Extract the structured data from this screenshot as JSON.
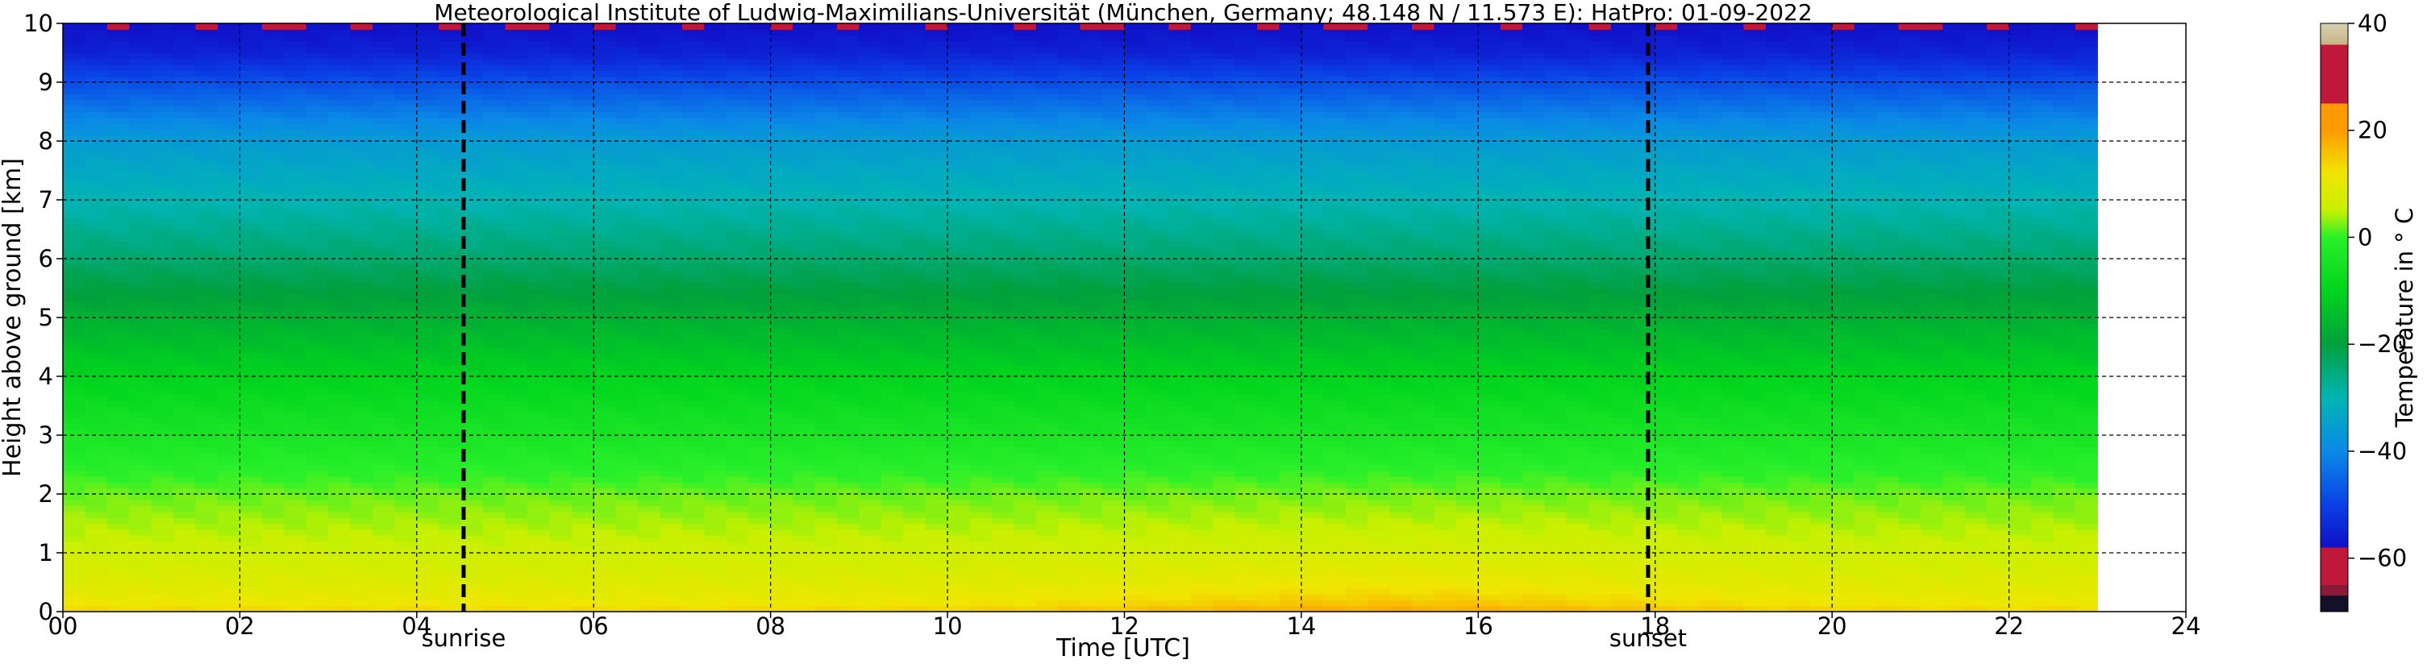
{
  "chart_data": {
    "type": "heatmap",
    "title": "Meteorological Institute of Ludwig-Maximilians-Universität (München, Germany; 48.148 N / 11.573 E):    HatPro: 01-09-2022",
    "xlabel": "Time [UTC]",
    "ylabel": "Height above ground [km]",
    "xlim": [
      0,
      24
    ],
    "ylim": [
      0,
      10
    ],
    "x_ticks": [
      0,
      2,
      4,
      6,
      8,
      10,
      12,
      14,
      16,
      18,
      20,
      22,
      24
    ],
    "x_tick_labels": [
      "00",
      "02",
      "04",
      "06",
      "08",
      "10",
      "12",
      "14",
      "16",
      "18",
      "20",
      "22",
      "24"
    ],
    "y_ticks": [
      0,
      1,
      2,
      3,
      4,
      5,
      6,
      7,
      8,
      9,
      10
    ],
    "y_tick_labels": [
      "0",
      "1",
      "2",
      "3",
      "4",
      "5",
      "6",
      "7",
      "8",
      "9",
      "10"
    ],
    "grid": true,
    "data_time_range": [
      0,
      23
    ],
    "events": [
      {
        "label": "sunrise",
        "time": 4.53
      },
      {
        "label": "sunset",
        "time": 17.92
      }
    ],
    "colorbar": {
      "label": "Temperature in ° C",
      "range": [
        -70,
        40
      ],
      "ticks": [
        -60,
        -40,
        -20,
        0,
        20,
        40
      ],
      "tick_labels": [
        "−60",
        "−40",
        "−20",
        "0",
        "20",
        "40"
      ],
      "stops": [
        {
          "value": -70,
          "color": "#14102a"
        },
        {
          "value": -67,
          "color": "#14102a"
        },
        {
          "value": -67,
          "color": "#8a1a3a"
        },
        {
          "value": -65,
          "color": "#8a1a3a"
        },
        {
          "value": -65,
          "color": "#c0183a"
        },
        {
          "value": -58,
          "color": "#c0183a"
        },
        {
          "value": -58,
          "color": "#1010c8"
        },
        {
          "value": -50,
          "color": "#0a40e6"
        },
        {
          "value": -40,
          "color": "#0a8ae6"
        },
        {
          "value": -30,
          "color": "#00b4b4"
        },
        {
          "value": -20,
          "color": "#00a03c"
        },
        {
          "value": -10,
          "color": "#00d41e"
        },
        {
          "value": 0,
          "color": "#2af02a"
        },
        {
          "value": 5,
          "color": "#c8f000"
        },
        {
          "value": 12,
          "color": "#f0e600"
        },
        {
          "value": 20,
          "color": "#ff9a00"
        },
        {
          "value": 20,
          "color": "#ff9a00"
        },
        {
          "value": 25,
          "color": "#ff9a00"
        },
        {
          "value": 25,
          "color": "#c0183a"
        },
        {
          "value": 36,
          "color": "#c0183a"
        },
        {
          "value": 36,
          "color": "#c8b482"
        },
        {
          "value": 40,
          "color": "#d7d2b4"
        }
      ]
    },
    "temperature_profile": {
      "height_km": [
        0,
        0.1,
        0.3,
        0.6,
        1.0,
        1.5,
        2.0,
        2.5,
        3.0,
        3.5,
        4.0,
        5.0,
        6.0,
        7.0,
        7.5,
        8.0,
        8.5,
        9.0,
        9.5,
        10.0
      ],
      "temp_c": [
        14,
        12,
        10,
        8,
        6,
        4,
        2,
        -1,
        -4,
        -7,
        -10,
        -17,
        -24,
        -30,
        -33,
        -36,
        -42,
        -48,
        -55,
        -58
      ]
    },
    "afternoon_surface_warming_c": 5
  }
}
